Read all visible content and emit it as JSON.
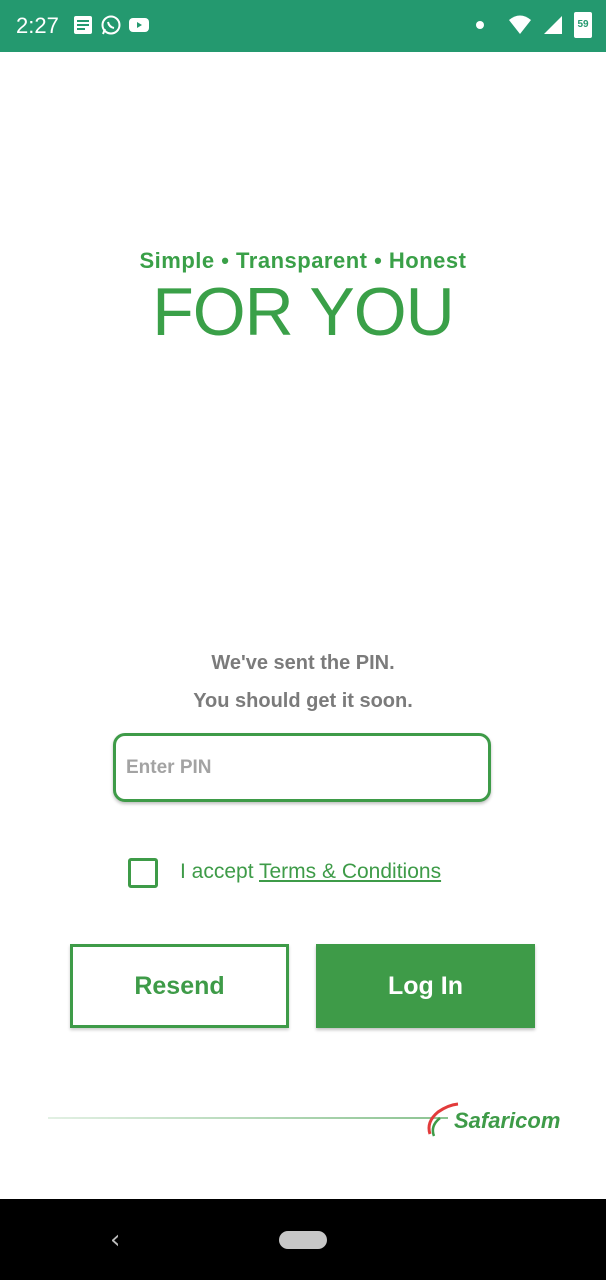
{
  "status_bar": {
    "time": "2:27",
    "battery": "59",
    "icons_left": [
      "notes-icon",
      "whatsapp-icon",
      "youtube-icon"
    ],
    "icons_right": [
      "dot-icon",
      "wifi-icon",
      "signal-icon",
      "battery-icon"
    ],
    "background": "#24996f"
  },
  "brand": {
    "tagline": "Simple • Transparent • Honest",
    "headline": "FOR YOU",
    "footer_brand": "Safaricom",
    "color": "#3aa048"
  },
  "message": {
    "line1": "We've sent the PIN.",
    "line2": "You should get it soon."
  },
  "pin": {
    "placeholder": "Enter PIN",
    "value": ""
  },
  "terms": {
    "prefix": "I accept ",
    "link_text": "Terms  & Conditions",
    "checked": false
  },
  "buttons": {
    "resend": "Resend",
    "login": "Log In"
  },
  "nav": {
    "back_glyph": "‹"
  }
}
